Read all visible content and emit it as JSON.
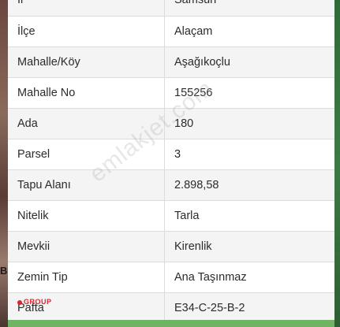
{
  "table": {
    "rows": [
      {
        "label": "İl",
        "value": "Samsun"
      },
      {
        "label": "İlçe",
        "value": "Alaçam"
      },
      {
        "label": "Mahalle/Köy",
        "value": "Aşağıkoçlu"
      },
      {
        "label": "Mahalle No",
        "value": "155256"
      },
      {
        "label": "Ada",
        "value": "180"
      },
      {
        "label": "Parsel",
        "value": "3"
      },
      {
        "label": "Tapu Alanı",
        "value": "2.898,58"
      },
      {
        "label": "Nitelik",
        "value": "Tarla"
      },
      {
        "label": "Mevkii",
        "value": "Kirenlik"
      },
      {
        "label": "Zemin Tip",
        "value": "Ana Taşınmaz"
      },
      {
        "label": "Pafta",
        "value": "E34-C-25-B-2"
      }
    ]
  },
  "watermark": "emlakjet.com",
  "logo_text": "GROUP",
  "edge_text": "B",
  "colors": {
    "row_alt": "#f4f4f4",
    "border": "#dcdcdc",
    "footer_green": "#6fb463",
    "logo_red": "#d9232d"
  }
}
